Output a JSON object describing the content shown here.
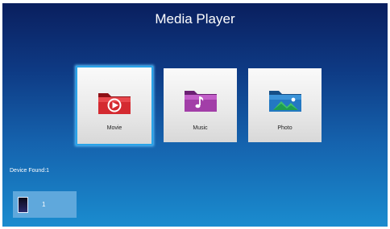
{
  "header": {
    "title": "Media Player"
  },
  "tiles": [
    {
      "label": "Movie",
      "icon": "movie-icon",
      "color": "#c0262c",
      "selected": true
    },
    {
      "label": "Music",
      "icon": "music-icon",
      "color": "#9a3a9c",
      "selected": false
    },
    {
      "label": "Photo",
      "icon": "photo-icon",
      "color": "#1f6fb5",
      "selected": false
    }
  ],
  "devices": {
    "status": "Device Found:1",
    "items": [
      {
        "label": "1",
        "icon": "storage-device-icon"
      }
    ]
  },
  "colors": {
    "selection_border": "#29a3e8",
    "device_item_bg": "#5fa8dc"
  }
}
